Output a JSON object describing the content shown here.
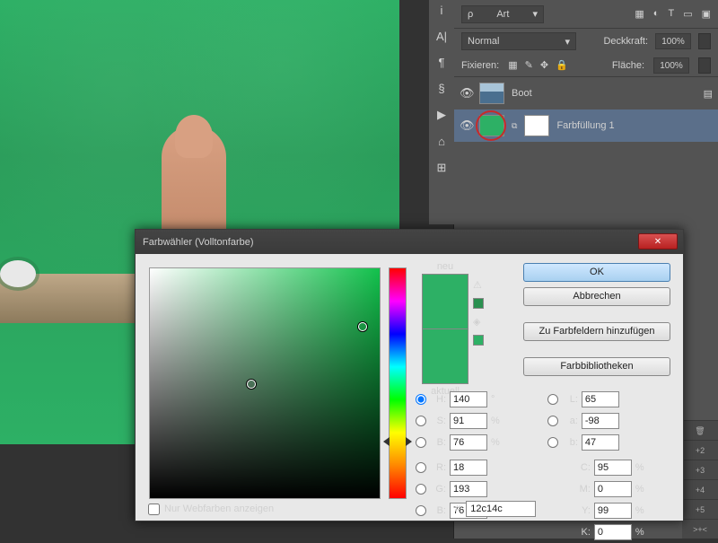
{
  "canvas": {
    "bg_hint": "green-tinted seascape"
  },
  "toolbar_vert": [
    "i",
    "A|",
    "¶",
    "§",
    "▶",
    "⌂",
    "⊞"
  ],
  "layers_panel": {
    "kind_label": "Art",
    "mode": "Normal",
    "opacity_label": "Deckkraft:",
    "opacity_value": "100%",
    "lock_label": "Fixieren:",
    "fill_label": "Fläche:",
    "fill_value": "100%",
    "layers": [
      {
        "name": "Boot",
        "selected": false
      },
      {
        "name": "Farbfüllung 1",
        "selected": true
      }
    ]
  },
  "dialog": {
    "title": "Farbwähler (Volltonfarbe)",
    "new_label": "neu",
    "current_label": "aktuell",
    "ok": "OK",
    "cancel": "Abbrechen",
    "add_swatch": "Zu Farbfeldern hinzufügen",
    "libraries": "Farbbibliotheken",
    "web_only": "Nur Webfarben anzeigen",
    "hex_label": "#",
    "hex_value": "12c14c",
    "preview_new": "#2db065",
    "preview_cur": "#2db065",
    "hsb": {
      "H": "140",
      "S": "91",
      "B": "76"
    },
    "rgb": {
      "R": "18",
      "G": "193",
      "B": "76"
    },
    "lab": {
      "L": "65",
      "a": "-98",
      "b": "47"
    },
    "cmyk": {
      "C": "95",
      "M": "0",
      "Y": "99",
      "K": "0"
    },
    "deg": "°",
    "pct": "%"
  },
  "stack": [
    "+2",
    "+3",
    "+4",
    "+5",
    ">+<"
  ]
}
